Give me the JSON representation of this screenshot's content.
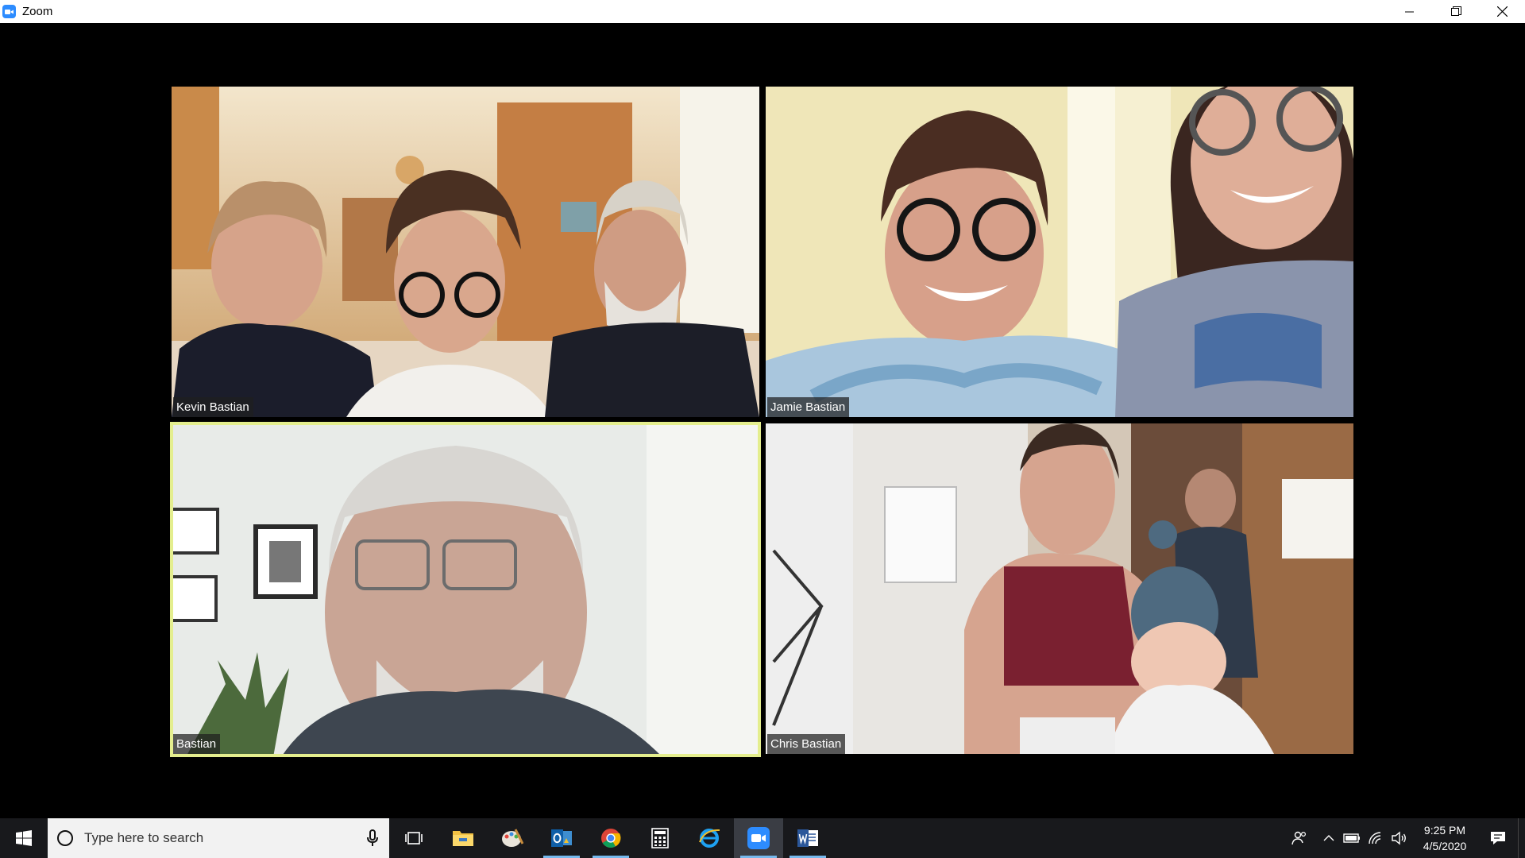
{
  "window": {
    "title": "Zoom"
  },
  "participants": [
    {
      "name": "Kevin Bastian"
    },
    {
      "name": "Jamie Bastian"
    },
    {
      "name": "Bastian",
      "active_speaker": true
    },
    {
      "name": "Chris Bastian"
    }
  ],
  "taskbar": {
    "search_placeholder": "Type here to search",
    "pinned": [
      "task-view",
      "file-explorer",
      "paint",
      "outlook",
      "chrome",
      "calculator",
      "internet-explorer",
      "zoom",
      "word"
    ],
    "clock": {
      "time": "9:25 PM",
      "date": "4/5/2020"
    }
  },
  "colors": {
    "active_speaker_border": "#e4ee8e",
    "zoom_brand": "#2d8cff",
    "taskbar": "#18191c"
  }
}
